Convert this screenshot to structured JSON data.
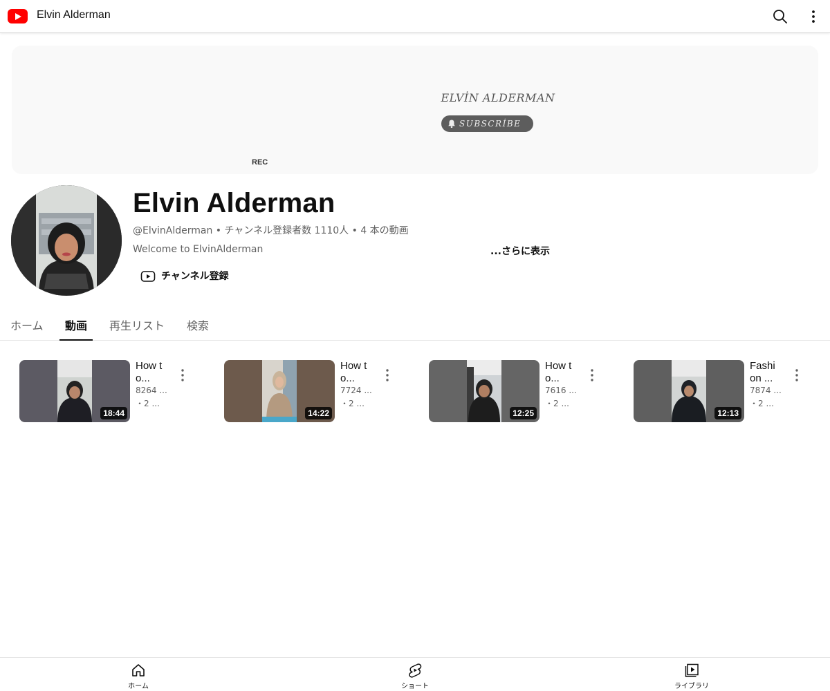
{
  "header": {
    "title": "Elvin Alderman",
    "logo_icon": "youtube-logo-icon",
    "search_icon": "search-icon",
    "more_icon": "more-vert-icon"
  },
  "banner": {
    "name": "ELVİN ALDERMAN",
    "subscribe": "SUBSCRİBE",
    "rec": "REC"
  },
  "channel": {
    "name": "Elvin Alderman",
    "meta": "@ElvinAlderman • チャンネル登録者数 1110人 • 4 本の動画",
    "description": "Welcome to ElvinAlderman",
    "show_more": "...さらに表示",
    "subscribe_label": "チャンネル登録"
  },
  "tabs": [
    {
      "label": "ホーム",
      "active": false
    },
    {
      "label": "動画",
      "active": true
    },
    {
      "label": "再生リスト",
      "active": false
    },
    {
      "label": "検索",
      "active": false
    }
  ],
  "videos": [
    {
      "title": "How to...",
      "views": "8264 ...",
      "age": "・2 ...",
      "duration": "18:44"
    },
    {
      "title": "How to...",
      "views": "7724 ...",
      "age": "・2 ...",
      "duration": "14:22"
    },
    {
      "title": "How to...",
      "views": "7616 ...",
      "age": "・2 ...",
      "duration": "12:25"
    },
    {
      "title": "Fashi on ...",
      "views": "7874 ...",
      "age": "・2 ...",
      "duration": "12:13"
    }
  ],
  "bottom_nav": [
    {
      "label": "ホーム",
      "icon": "home-icon"
    },
    {
      "label": "ショート",
      "icon": "shorts-icon"
    },
    {
      "label": "ライブラリ",
      "icon": "library-icon"
    }
  ],
  "colors": {
    "brand_red": "#ff0000",
    "text_primary": "#0f0f0f",
    "text_secondary": "#606060"
  }
}
